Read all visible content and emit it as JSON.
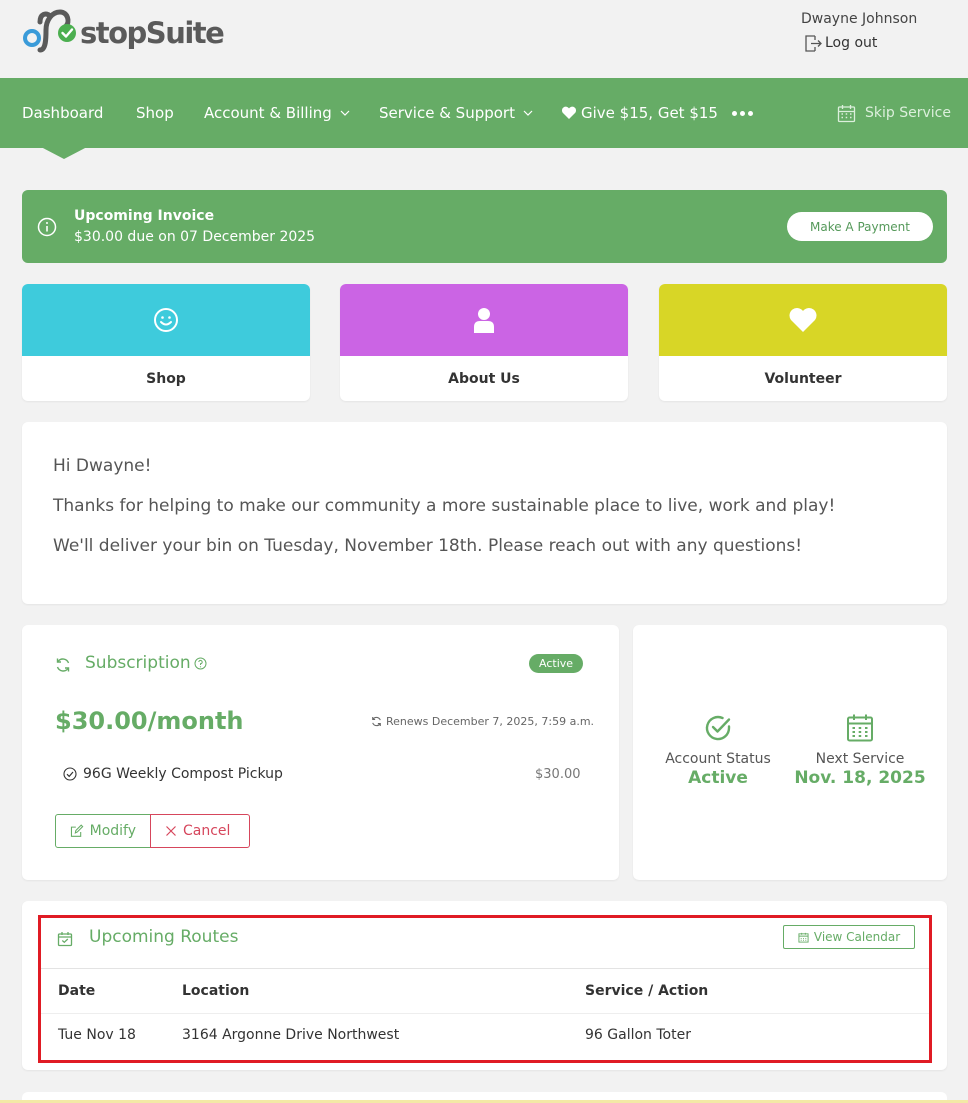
{
  "brand": {
    "name": "stopSuite",
    "accent": "#66ac66"
  },
  "user": {
    "name": "Dwayne Johnson",
    "logout_label": "Log out"
  },
  "nav": {
    "items": [
      {
        "label": "Dashboard"
      },
      {
        "label": "Shop"
      },
      {
        "label": "Account & Billing"
      },
      {
        "label": "Service & Support"
      },
      {
        "label": "Give $15, Get $15"
      }
    ],
    "skip_label": "Skip Service"
  },
  "invoice": {
    "title": "Upcoming Invoice",
    "subtitle": "$30.00 due on 07 December 2025",
    "button": "Make A Payment"
  },
  "tiles": [
    {
      "label": "Shop",
      "color": "#3ecbdc",
      "icon": "smile-icon"
    },
    {
      "label": "About Us",
      "color": "#cb64e4",
      "icon": "user-icon"
    },
    {
      "label": "Volunteer",
      "color": "#d8d626",
      "icon": "heart-icon"
    }
  ],
  "welcome": {
    "greeting": "Hi Dwayne!",
    "line1": "Thanks for helping to make our community a more sustainable place to live, work and play!",
    "line2": "We'll deliver your bin on Tuesday, November 18th. Please reach out with any questions!"
  },
  "subscription": {
    "title": "Subscription",
    "status_badge": "Active",
    "price": "$30.00/month",
    "renews": "Renews December 7, 2025, 7:59 a.m.",
    "item_name": "96G Weekly Compost Pickup",
    "item_price": "$30.00",
    "modify_label": "Modify",
    "cancel_label": "Cancel"
  },
  "status": {
    "account_label": "Account Status",
    "account_value": "Active",
    "next_label": "Next Service",
    "next_value": "Nov. 18, 2025"
  },
  "routes": {
    "title": "Upcoming Routes",
    "view_calendar": "View Calendar",
    "columns": [
      "Date",
      "Location",
      "Service / Action"
    ],
    "rows": [
      [
        "Tue Nov 18",
        "3164 Argonne Drive Northwest",
        "96 Gallon Toter"
      ]
    ]
  }
}
